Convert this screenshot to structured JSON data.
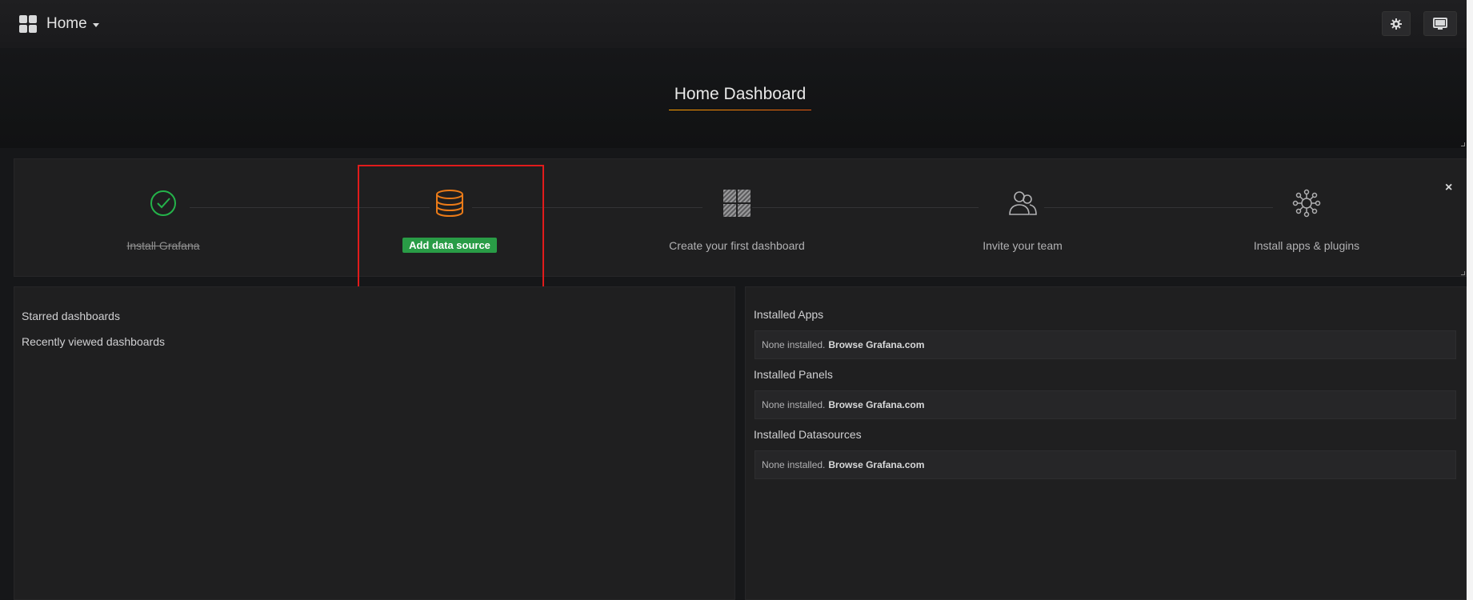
{
  "navbar": {
    "home_label": "Home"
  },
  "dashboard": {
    "title": "Home Dashboard"
  },
  "getting_started": {
    "steps": [
      {
        "label": "Install Grafana",
        "state": "done",
        "icon": "check-circle-icon"
      },
      {
        "label": "Add data source",
        "state": "active",
        "icon": "database-icon"
      },
      {
        "label": "Create your first dashboard",
        "state": "todo",
        "icon": "dashboard-grid-icon"
      },
      {
        "label": "Invite your team",
        "state": "todo",
        "icon": "users-icon"
      },
      {
        "label": "Install apps & plugins",
        "state": "todo",
        "icon": "plugins-icon"
      }
    ],
    "close_label": "×"
  },
  "left_panel": {
    "starred": "Starred dashboards",
    "recent": "Recently viewed dashboards"
  },
  "right_panel": {
    "sections": [
      {
        "title": "Installed Apps",
        "text": "None installed.",
        "link": "Browse Grafana.com"
      },
      {
        "title": "Installed Panels",
        "text": "None installed.",
        "link": "Browse Grafana.com"
      },
      {
        "title": "Installed Datasources",
        "text": "None installed.",
        "link": "Browse Grafana.com"
      }
    ]
  },
  "colors": {
    "background": "#161719",
    "panel": "#1f1f20",
    "accent_green": "#299c46",
    "accent_orange": "#eb7b18",
    "highlight_red": "#e11b1b"
  }
}
